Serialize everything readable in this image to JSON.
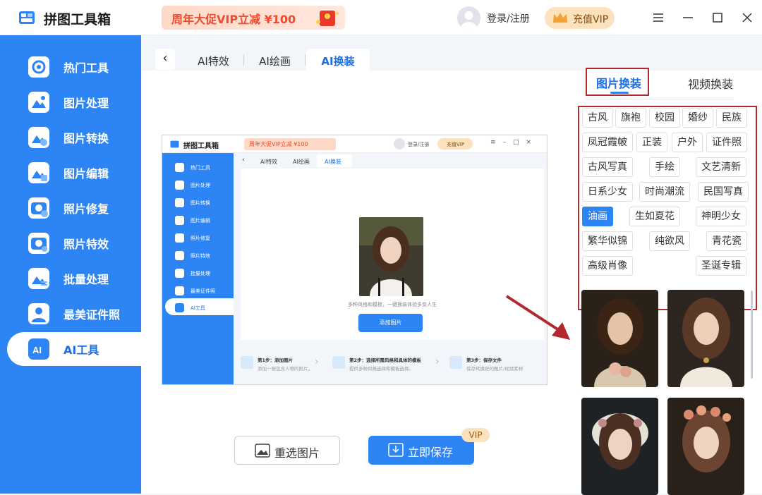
{
  "app": {
    "title": "拼图工具箱",
    "promo": "周年大促VIP立减 ¥100",
    "login": "登录/注册",
    "vip_button": "充值VIP"
  },
  "sidebar": {
    "items": [
      {
        "label": "热门工具",
        "icon": "hot-tools-icon"
      },
      {
        "label": "图片处理",
        "icon": "image-process-icon"
      },
      {
        "label": "图片转换",
        "icon": "image-convert-icon"
      },
      {
        "label": "图片编辑",
        "icon": "image-edit-icon"
      },
      {
        "label": "照片修复",
        "icon": "photo-repair-icon"
      },
      {
        "label": "照片特效",
        "icon": "photo-effects-icon"
      },
      {
        "label": "批量处理",
        "icon": "batch-process-icon"
      },
      {
        "label": "最美证件照",
        "icon": "id-photo-icon"
      },
      {
        "label": "AI工具",
        "icon": "ai-tools-icon",
        "active": true
      }
    ]
  },
  "tabs": [
    {
      "label": "AI特效"
    },
    {
      "label": "AI绘画"
    },
    {
      "label": "AI换装",
      "active": true
    }
  ],
  "preview": {
    "title": "拼图工具箱",
    "promo": "周年大促VIP立减 ¥100",
    "login": "登录/注册",
    "vip": "充值VIP",
    "tabs": [
      "AI特效",
      "AI绘画",
      "AI换装"
    ],
    "sidebar": [
      "热门工具",
      "图片处理",
      "图片转换",
      "图片编辑",
      "照片修复",
      "照片特效",
      "批量处理",
      "最美证件照",
      "AI工具"
    ],
    "caption": "多种风格和模板，一键换装体验多变人生",
    "add_button": "添加图片",
    "steps": [
      {
        "title": "第1步：添加图片",
        "desc": "添加一张包含人物的照片。"
      },
      {
        "title": "第2步：选择所需风格和具体的模板",
        "desc": "提供多种风格选择和模板选择。"
      },
      {
        "title": "第3步：保存文件",
        "desc": "保存转换好的图片/视频素材"
      }
    ]
  },
  "actions": {
    "reselect": "重选图片",
    "save": "立即保存",
    "vip_tag": "VIP"
  },
  "right_panel": {
    "tabs": [
      {
        "label": "图片换装",
        "active": true
      },
      {
        "label": "视频换装"
      }
    ],
    "styles": [
      "古风",
      "旗袍",
      "校园",
      "婚纱",
      "民族",
      "凤冠霞帔",
      "正装",
      "户外",
      "证件照",
      "古风写真",
      "手绘",
      "文艺清新",
      "日系少女",
      "时尚潮流",
      "民国写真",
      "油画",
      "生如夏花",
      "神明少女",
      "繁华似锦",
      "纯欲风",
      "青花瓷",
      "高级肖像",
      "圣诞专辑"
    ],
    "selected_style": "油画"
  },
  "colors": {
    "primary": "#2c84f5",
    "highlight": "#b2282c",
    "vip": "#fbe2bc"
  }
}
